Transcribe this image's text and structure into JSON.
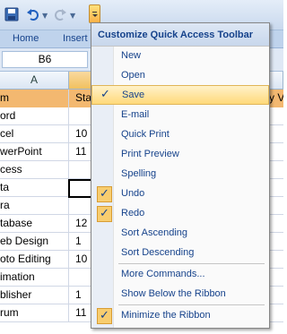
{
  "quick_access": {
    "save_icon": "save-icon",
    "undo_icon": "undo-icon",
    "redo_icon": "redo-icon",
    "customize_icon": "customize-dropdown-icon"
  },
  "ribbon": {
    "tabs": [
      {
        "label": "Home"
      },
      {
        "label": "Insert"
      }
    ]
  },
  "name_box": {
    "value": "B6"
  },
  "grid": {
    "column_headers": [
      "A",
      "",
      ""
    ],
    "rows": [
      {
        "a": "m",
        "b": "Sta",
        "c": "ry V",
        "header": true
      },
      {
        "a": "ord",
        "b": "",
        "c": ""
      },
      {
        "a": "cel",
        "b": "10",
        "c": ""
      },
      {
        "a": "werPoint",
        "b": "11",
        "c": ""
      },
      {
        "a": "cess",
        "b": "",
        "c": ""
      },
      {
        "a": "ta",
        "b": "",
        "c": ""
      },
      {
        "a": "ra",
        "b": "",
        "c": ""
      },
      {
        "a": "tabase",
        "b": "12",
        "c": ""
      },
      {
        "a": "eb Design",
        "b": "1",
        "c": ""
      },
      {
        "a": "oto Editing",
        "b": "10",
        "c": ""
      },
      {
        "a": "imation",
        "b": "",
        "c": ""
      },
      {
        "a": "blisher",
        "b": "1",
        "c": ""
      },
      {
        "a": "rum",
        "b": "11",
        "c": ""
      }
    ]
  },
  "menu": {
    "title": "Customize Quick Access Toolbar",
    "items": [
      {
        "label": "New",
        "checked": false
      },
      {
        "label": "Open",
        "checked": false
      },
      {
        "label": "Save",
        "checked": true,
        "highlighted": true
      },
      {
        "label": "E-mail",
        "checked": false
      },
      {
        "label": "Quick Print",
        "checked": false
      },
      {
        "label": "Print Preview",
        "checked": false
      },
      {
        "label": "Spelling",
        "checked": false
      },
      {
        "label": "Undo",
        "checked": true
      },
      {
        "label": "Redo",
        "checked": true
      },
      {
        "label": "Sort Ascending",
        "checked": false
      },
      {
        "label": "Sort Descending",
        "checked": false
      },
      {
        "label": "More Commands...",
        "checked": false
      },
      {
        "label": "Show Below the Ribbon",
        "checked": false
      },
      {
        "label": "Minimize the Ribbon",
        "checked": true
      }
    ]
  },
  "colors": {
    "accent": "#15428b",
    "highlight": "#ffd97a",
    "check_bg": "#f8cd6f"
  }
}
